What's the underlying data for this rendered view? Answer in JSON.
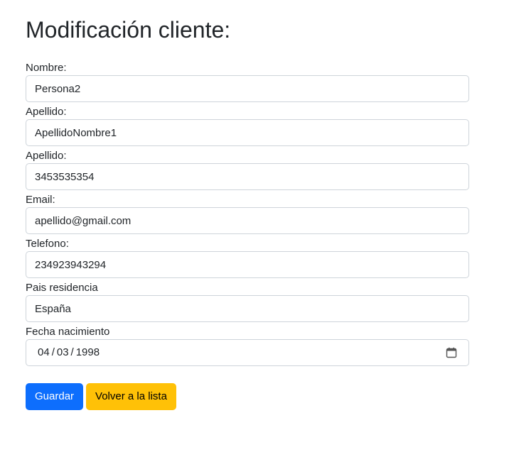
{
  "page": {
    "title": "Modificación cliente:"
  },
  "form": {
    "nombre": {
      "label": "Nombre:",
      "value": "Persona2"
    },
    "apellido": {
      "label": "Apellido:",
      "value": "ApellidoNombre1"
    },
    "apellido2": {
      "label": "Apellido:",
      "value": "3453535354"
    },
    "email": {
      "label": "Email:",
      "value": "apellido@gmail.com"
    },
    "telefono": {
      "label": "Telefono:",
      "value": "234923943294"
    },
    "pais": {
      "label": "Pais residencia",
      "value": "España"
    },
    "fecha": {
      "label": "Fecha nacimiento",
      "day": "04",
      "month": "03",
      "year": "1998",
      "separator": "/"
    }
  },
  "actions": {
    "save_label": "Guardar",
    "back_label": "Volver a la lista"
  },
  "colors": {
    "primary": "#0d6efd",
    "warning": "#ffc107",
    "border": "#ced4da",
    "text": "#212529"
  },
  "icons": {
    "date_picker": "calendar-icon"
  }
}
